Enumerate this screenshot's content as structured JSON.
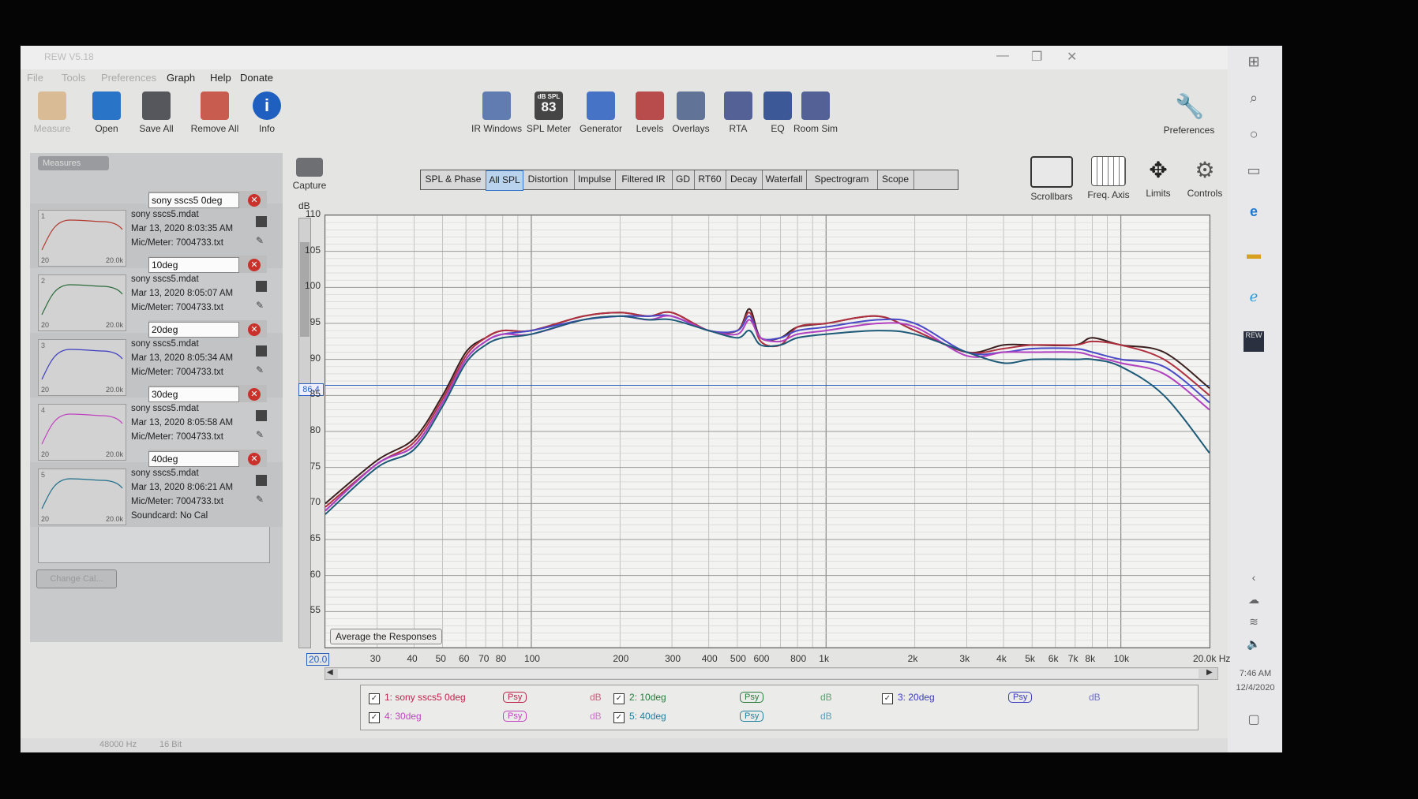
{
  "window": {
    "title": "REW V5.18",
    "controls": {
      "minimize": "—",
      "restore": "❐",
      "close": "✕"
    }
  },
  "menu": [
    "File",
    "Tools",
    "Preferences",
    "Graph",
    "Help",
    "Donate"
  ],
  "left_toolbar": [
    {
      "label": "Measure",
      "icon": "measure-icon"
    },
    {
      "label": "Open",
      "icon": "folder-icon"
    },
    {
      "label": "Save All",
      "icon": "save-icon"
    },
    {
      "label": "Remove All",
      "icon": "remove-all-icon"
    },
    {
      "label": "Info",
      "icon": "info-icon"
    }
  ],
  "center_toolbar": [
    {
      "label": "IR Windows",
      "icon": "ir-windows-icon"
    },
    {
      "label": "SPL Meter",
      "icon": "spl-meter-icon",
      "readout": "83",
      "unit": "dB SPL"
    },
    {
      "label": "Generator",
      "icon": "generator-icon"
    },
    {
      "label": "Levels",
      "icon": "levels-icon"
    },
    {
      "label": "Overlays",
      "icon": "overlays-icon"
    },
    {
      "label": "RTA",
      "icon": "rta-icon"
    },
    {
      "label": "EQ",
      "icon": "eq-icon"
    },
    {
      "label": "Room Sim",
      "icon": "room-sim-icon"
    }
  ],
  "preferences": {
    "label": "Preferences",
    "icon": "wrench-icon"
  },
  "graph_controls": [
    {
      "label": "Scrollbars",
      "icon": "scrollbars-icon"
    },
    {
      "label": "Freq. Axis",
      "icon": "freq-axis-icon"
    },
    {
      "label": "Limits",
      "icon": "limits-icon"
    },
    {
      "label": "Controls",
      "icon": "controls-icon"
    }
  ],
  "capture": {
    "label": "Capture",
    "icon": "camera-icon"
  },
  "tabs": [
    "SPL & Phase",
    "All SPL",
    "Distortion",
    "Impulse",
    "Filtered IR",
    "GD",
    "RT60",
    "Decay",
    "Waterfall",
    "Spectrogram",
    "Scope"
  ],
  "active_tab": "All SPL",
  "measurements_header": "Measures",
  "measurements": [
    {
      "name": "sony sscs5 0deg",
      "file": "sony sscs5.mdat",
      "date": "Mar 13, 2020 8:03:35 AM",
      "mic": "Mic/Meter: 7004733.txt",
      "color": "#b23a30",
      "index": "1"
    },
    {
      "name": "10deg",
      "file": "sony sscs5.mdat",
      "date": "Mar 13, 2020 8:05:07 AM",
      "mic": "Mic/Meter: 7004733.txt",
      "color": "#2a6b3a",
      "index": "2"
    },
    {
      "name": "20deg",
      "file": "sony sscs5.mdat",
      "date": "Mar 13, 2020 8:05:34 AM",
      "mic": "Mic/Meter: 7004733.txt",
      "color": "#3c3cc0",
      "index": "3"
    },
    {
      "name": "30deg",
      "file": "sony sscs5.mdat",
      "date": "Mar 13, 2020 8:05:58 AM",
      "mic": "Mic/Meter: 7004733.txt",
      "color": "#c043c0",
      "index": "4"
    },
    {
      "name": "40deg",
      "file": "sony sscs5.mdat",
      "date": "Mar 13, 2020 8:06:21 AM",
      "mic": "Mic/Meter: 7004733.txt",
      "soundcard": "Soundcard: No Cal",
      "color": "#1f6f8a",
      "index": "5"
    }
  ],
  "thumb_labels": {
    "left": "20",
    "right": "20.0k"
  },
  "change_cal": "Change Cal...",
  "average_button": "Average the Responses",
  "cursor_readout": "86.4",
  "legend": [
    {
      "label": "1: sony sscs5 0deg",
      "psy": "Psy",
      "unit": "dB",
      "color": "#c0234a"
    },
    {
      "label": "2: 10deg",
      "psy": "Psy",
      "unit": "dB",
      "color": "#2a7a3a"
    },
    {
      "label": "3: 20deg",
      "psy": "Psy",
      "unit": "dB",
      "color": "#3c3cc0"
    },
    {
      "label": "4: 30deg",
      "psy": "Psy",
      "unit": "dB",
      "color": "#c043c0"
    },
    {
      "label": "5: 40deg",
      "psy": "Psy",
      "unit": "dB",
      "color": "#1f7f9a"
    }
  ],
  "status": {
    "rate": "48000 Hz",
    "bits": "16 Bit"
  },
  "clock": {
    "time": "7:46 AM",
    "date": "12/4/2020"
  },
  "chart_data": {
    "type": "line",
    "ylabel": "dB",
    "xlabel": "",
    "x_unit": "Hz",
    "xscale": "log",
    "xlim": [
      20,
      20000
    ],
    "ylim": [
      50,
      110
    ],
    "yticks": [
      55,
      60,
      65,
      70,
      75,
      80,
      85,
      90,
      95,
      100,
      105,
      110
    ],
    "xticks": [
      {
        "v": 20,
        "t": "20.0"
      },
      {
        "v": 30,
        "t": "30"
      },
      {
        "v": 40,
        "t": "40"
      },
      {
        "v": 50,
        "t": "50"
      },
      {
        "v": 60,
        "t": "60"
      },
      {
        "v": 70,
        "t": "70"
      },
      {
        "v": 80,
        "t": "80"
      },
      {
        "v": 100,
        "t": "100"
      },
      {
        "v": 200,
        "t": "200"
      },
      {
        "v": 300,
        "t": "300"
      },
      {
        "v": 400,
        "t": "400"
      },
      {
        "v": 500,
        "t": "500"
      },
      {
        "v": 600,
        "t": "600"
      },
      {
        "v": 800,
        "t": "800"
      },
      {
        "v": 1000,
        "t": "1k"
      },
      {
        "v": 2000,
        "t": "2k"
      },
      {
        "v": 3000,
        "t": "3k"
      },
      {
        "v": 4000,
        "t": "4k"
      },
      {
        "v": 5000,
        "t": "5k"
      },
      {
        "v": 6000,
        "t": "6k"
      },
      {
        "v": 7000,
        "t": "7k"
      },
      {
        "v": 8000,
        "t": "8k"
      },
      {
        "v": 10000,
        "t": "10k"
      },
      {
        "v": 20000,
        "t": "20.0k Hz"
      }
    ],
    "grid": true,
    "cursor_y": 86.4,
    "x": [
      20,
      30,
      40,
      50,
      60,
      70,
      80,
      100,
      150,
      200,
      250,
      300,
      400,
      500,
      550,
      600,
      700,
      800,
      1000,
      1500,
      2000,
      3000,
      4000,
      5000,
      7000,
      8000,
      10000,
      14000,
      20000
    ],
    "series": [
      {
        "name": "1: sony sscs5 0deg",
        "color": "#3a1f1f",
        "values": [
          70,
          76,
          79,
          85,
          91,
          93,
          94,
          94,
          96,
          96.5,
          96,
          96.5,
          94,
          94,
          97,
          93,
          93,
          94.5,
          95,
          96,
          94,
          91,
          92,
          92,
          92,
          93,
          92,
          91,
          86
        ]
      },
      {
        "name": "2: 10deg",
        "color": "#b03040",
        "values": [
          69.5,
          75.5,
          78.5,
          84.5,
          90.5,
          93,
          94,
          94,
          96,
          96.5,
          96,
          96.5,
          94,
          94,
          96.5,
          92.5,
          92,
          94.5,
          95,
          96,
          94,
          91,
          91.5,
          92,
          92,
          92.5,
          92,
          90,
          85
        ]
      },
      {
        "name": "3: 20deg",
        "color": "#4a4ac8",
        "values": [
          69,
          75.5,
          78,
          84,
          90,
          92.5,
          93.5,
          94,
          95.5,
          96,
          96,
          96,
          94,
          94,
          96,
          93,
          93,
          94,
          94.5,
          95.5,
          95,
          91,
          91,
          91.5,
          91.5,
          91,
          90,
          89,
          84
        ]
      },
      {
        "name": "4: 30deg",
        "color": "#b040c0",
        "values": [
          69,
          75.5,
          78,
          84,
          90,
          92.5,
          93.5,
          93.5,
          95.5,
          96,
          95.5,
          96,
          94,
          93.5,
          95.5,
          93,
          92.5,
          93.5,
          94,
          95,
          94.5,
          90.5,
          91,
          91,
          91,
          90.5,
          89.5,
          88,
          83
        ]
      },
      {
        "name": "5: 40deg",
        "color": "#1c5a78",
        "values": [
          68.5,
          75,
          77.5,
          83.5,
          89.5,
          92,
          93,
          93.5,
          95.5,
          96,
          95.5,
          95.5,
          94,
          93,
          94,
          92,
          92,
          93,
          93.5,
          94,
          93.5,
          91,
          89.5,
          90,
          90,
          90,
          89,
          85,
          77
        ]
      }
    ]
  }
}
